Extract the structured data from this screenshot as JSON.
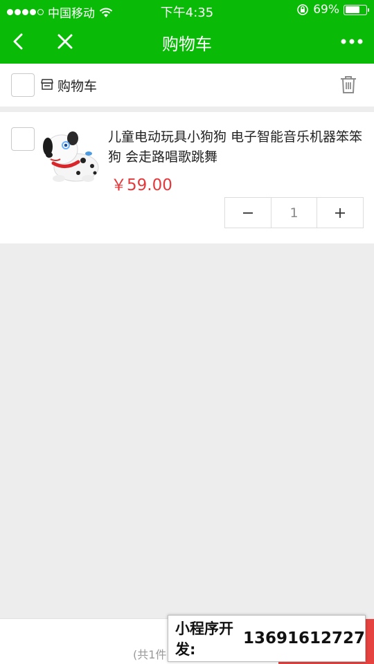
{
  "status_bar": {
    "carrier": "中国移动",
    "time": "下午4:35",
    "battery_percent": "69%",
    "battery_level": 0.69
  },
  "nav": {
    "title": "购物车",
    "back_icon": "chevron-left-icon",
    "close_icon": "close-icon",
    "more_icon": "more-dots-icon"
  },
  "shop": {
    "title": "购物车",
    "shop_icon": "store-icon",
    "delete_icon": "trash-icon"
  },
  "cart_items": [
    {
      "name": "儿童电动玩具小狗狗 电子智能音乐机器笨笨狗 会走路唱歌跳舞",
      "price": "￥59.00",
      "quantity": "1",
      "image": "toy-dog-image"
    }
  ],
  "stepper": {
    "minus": "−",
    "plus": "+"
  },
  "footer": {
    "total_text": "(共1件"
  },
  "promo": {
    "label": "小程序开发:",
    "phone": "13691612727"
  },
  "colors": {
    "brand_green": "#09bb07",
    "price_red": "#e4393c",
    "checkout_red": "#e64340"
  }
}
